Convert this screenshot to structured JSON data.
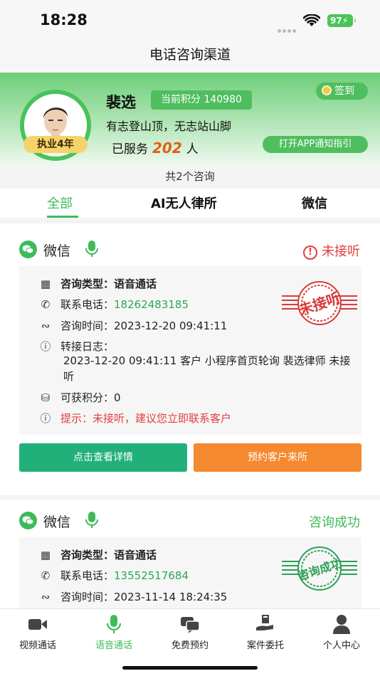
{
  "status_bar": {
    "time": "18:28",
    "battery": "97"
  },
  "nav": {
    "title": "电话咨询渠道"
  },
  "profile": {
    "name": "裴选",
    "points_label": "当前积分 140980",
    "signin_label": "签到",
    "motto": "有志登山顶，无志站山脚",
    "served_prefix": "已服务",
    "served_count": "202",
    "served_suffix": "人",
    "years_badge": "执业4年",
    "notify_label": "打开APP通知指引"
  },
  "summary": {
    "count_text": "共2个咨询"
  },
  "tabs": [
    {
      "label": "全部"
    },
    {
      "label": "AI无人律所"
    },
    {
      "label": "微信"
    }
  ],
  "consultations": [
    {
      "channel": "微信",
      "status": "未接听",
      "type_label": "咨询类型：",
      "type_value": "语音通话",
      "phone_label": "联系电话：",
      "phone": "18262483185",
      "time_label": "咨询时间：",
      "time": "2023-12-20 09:41:11",
      "log_label": "转接日志：",
      "log": "2023-12-20 09:41:11 客户 小程序首页轮询 裴选律师 未接听",
      "points_label": "可获积分：",
      "points": "0",
      "tip": "提示：未接听，建议您立即联系客户",
      "stamp": "未接听",
      "detail_button": "点击查看详情",
      "appoint_button": "预约客户来所"
    },
    {
      "channel": "微信",
      "status": "咨询成功",
      "type_label": "咨询类型：",
      "type_value": "语音通话",
      "phone_label": "联系电话：",
      "phone": "13552517684",
      "time_label": "咨询时间：",
      "time": "2023-11-14 18:24:35",
      "stamp": "咨询成功"
    }
  ],
  "tabbar": [
    {
      "label": "视频通话",
      "icon": "video-camera-icon"
    },
    {
      "label": "语音通话",
      "icon": "microphone-icon"
    },
    {
      "label": "免费预约",
      "icon": "chat-bubbles-icon"
    },
    {
      "label": "案件委托",
      "icon": "case-hand-icon"
    },
    {
      "label": "个人中心",
      "icon": "person-icon"
    }
  ],
  "colors": {
    "brand_green": "#3fbb5a",
    "alert_red": "#e33e3e",
    "orange": "#f5892f",
    "teal_button": "#22b07a"
  }
}
